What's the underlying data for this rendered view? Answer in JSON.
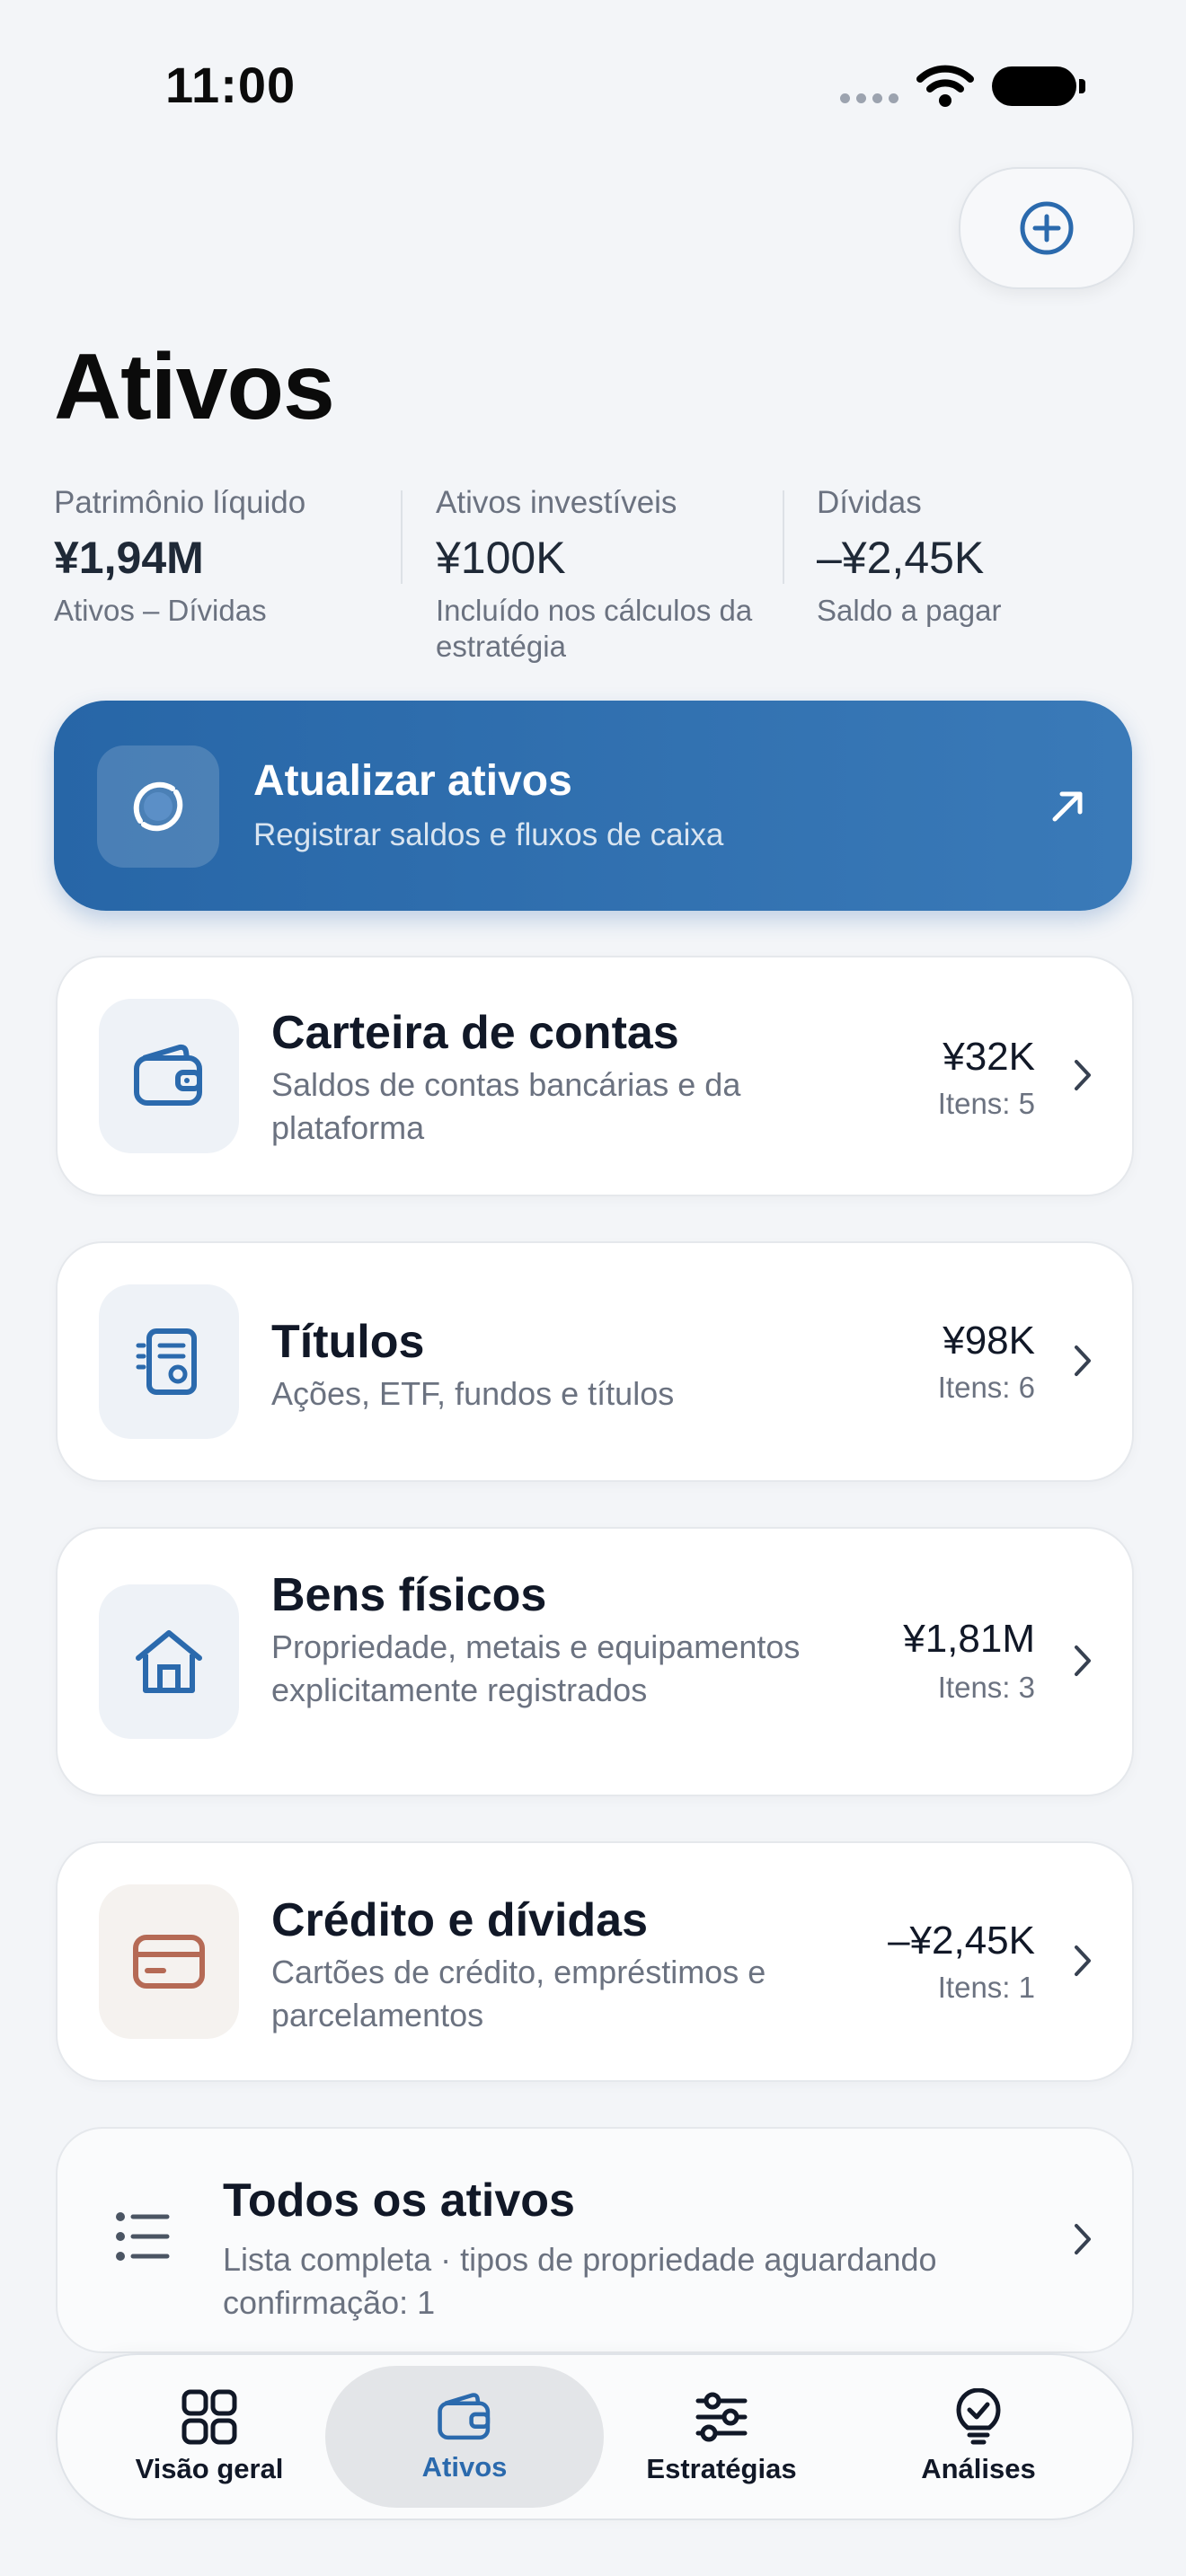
{
  "status_bar": {
    "time": "11:00"
  },
  "header": {
    "title": "Ativos",
    "add_icon": "plus-circle-icon"
  },
  "summary": [
    {
      "label": "Patrimônio líquido",
      "value": "¥1,94M",
      "sub": "Ativos – Dívidas"
    },
    {
      "label": "Ativos investíveis",
      "value": "¥100K",
      "sub": "Incluído nos cálculos da estratégia"
    },
    {
      "label": "Dívidas",
      "value": "–¥2,45K",
      "sub": "Saldo a pagar"
    }
  ],
  "update_card": {
    "title": "Atualizar ativos",
    "subtitle": "Registrar saldos e fluxos de caixa",
    "icon": "sync-icon",
    "arrow_icon": "arrow-up-right-icon"
  },
  "categories": [
    {
      "title": "Carteira de contas",
      "description": "Saldos de contas bancárias e da plataforma",
      "amount": "¥32K",
      "count": "Itens: 5",
      "icon": "wallet-icon"
    },
    {
      "title": "Títulos",
      "description": "Ações, ETF, fundos e títulos",
      "amount": "¥98K",
      "count": "Itens: 6",
      "icon": "document-certificate-icon"
    },
    {
      "title": "Bens físicos",
      "description": "Propriedade, metais e equipamentos explicitamente registrados",
      "amount": "¥1,81M",
      "count": "Itens: 3",
      "icon": "house-icon"
    },
    {
      "title": "Crédito e dívidas",
      "description": "Cartões de crédito, empréstimos e parcelamentos",
      "amount": "–¥2,45K",
      "count": "Itens: 1",
      "icon": "credit-card-icon"
    }
  ],
  "all_assets": {
    "title": "Todos os ativos",
    "description": "Lista completa · tipos de propriedade aguardando confirmação: 1",
    "icon": "list-icon"
  },
  "tabs": [
    {
      "label": "Visão geral",
      "icon": "grid-icon",
      "active": false
    },
    {
      "label": "Ativos",
      "icon": "wallet-icon",
      "active": true
    },
    {
      "label": "Estratégias",
      "icon": "sliders-icon",
      "active": false
    },
    {
      "label": "Análises",
      "icon": "lightbulb-icon",
      "active": false
    }
  ],
  "colors": {
    "accent": "#2b6aad",
    "update_card": "#2e6fae",
    "debt_icon": "#b56a55"
  }
}
